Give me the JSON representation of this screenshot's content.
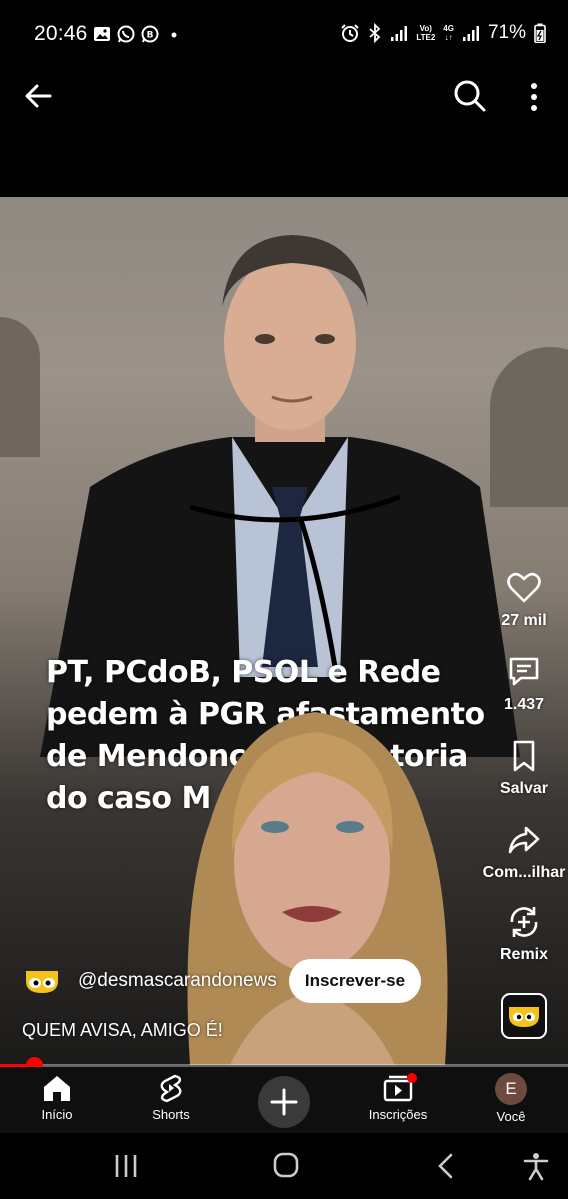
{
  "status_bar": {
    "time": "20:46",
    "left_icons": [
      "gallery-icon",
      "whatsapp-icon",
      "whatsapp-business-icon",
      "dot-icon"
    ],
    "right_icons": [
      "alarm-icon",
      "bluetooth-icon",
      "signal-icon",
      "volte-icon",
      "4g-icon",
      "signal-icon-2",
      "battery-icon"
    ],
    "volte_label": "Vo)\nLTE2",
    "network_label": "4G",
    "battery": "71%"
  },
  "toolbar": {
    "back_icon": "arrow-left-icon",
    "search_icon": "search-icon",
    "more_icon": "more-vertical-icon"
  },
  "video": {
    "headline_lines": [
      "PT, PCdoB, PSOL e Rede",
      "pedem à PGR afastamento",
      "de Mendonça da relatoria",
      "do caso M"
    ]
  },
  "actions": {
    "like": {
      "icon": "heart-icon",
      "label": "27 mil"
    },
    "comments": {
      "icon": "comment-icon",
      "label": "1.437"
    },
    "save": {
      "icon": "bookmark-icon",
      "label": "Salvar"
    },
    "share": {
      "icon": "share-icon",
      "label": "Com...ilhar"
    },
    "remix": {
      "icon": "remix-icon",
      "label": "Remix"
    }
  },
  "channel": {
    "handle": "@desmascarandonews",
    "subscribe_label": "Inscrever-se",
    "caption": "QUEM AVISA, AMIGO É!"
  },
  "progress": {
    "fraction": 0.06
  },
  "bottom_nav": {
    "home": {
      "icon": "home-icon",
      "label": "Início"
    },
    "shorts": {
      "icon": "shorts-icon",
      "label": "Shorts"
    },
    "create": {
      "icon": "plus-icon"
    },
    "subscriptions": {
      "icon": "subscriptions-icon",
      "label": "Inscrições"
    },
    "you": {
      "icon": "avatar",
      "initial": "E",
      "label": "Você"
    }
  },
  "system_nav": [
    "recent-apps-icon",
    "home-circle-icon",
    "back-chevron-icon",
    "accessibility-icon"
  ],
  "colors": {
    "accent_red": "#ff0000",
    "nav_bg": "#0f0f0f"
  }
}
